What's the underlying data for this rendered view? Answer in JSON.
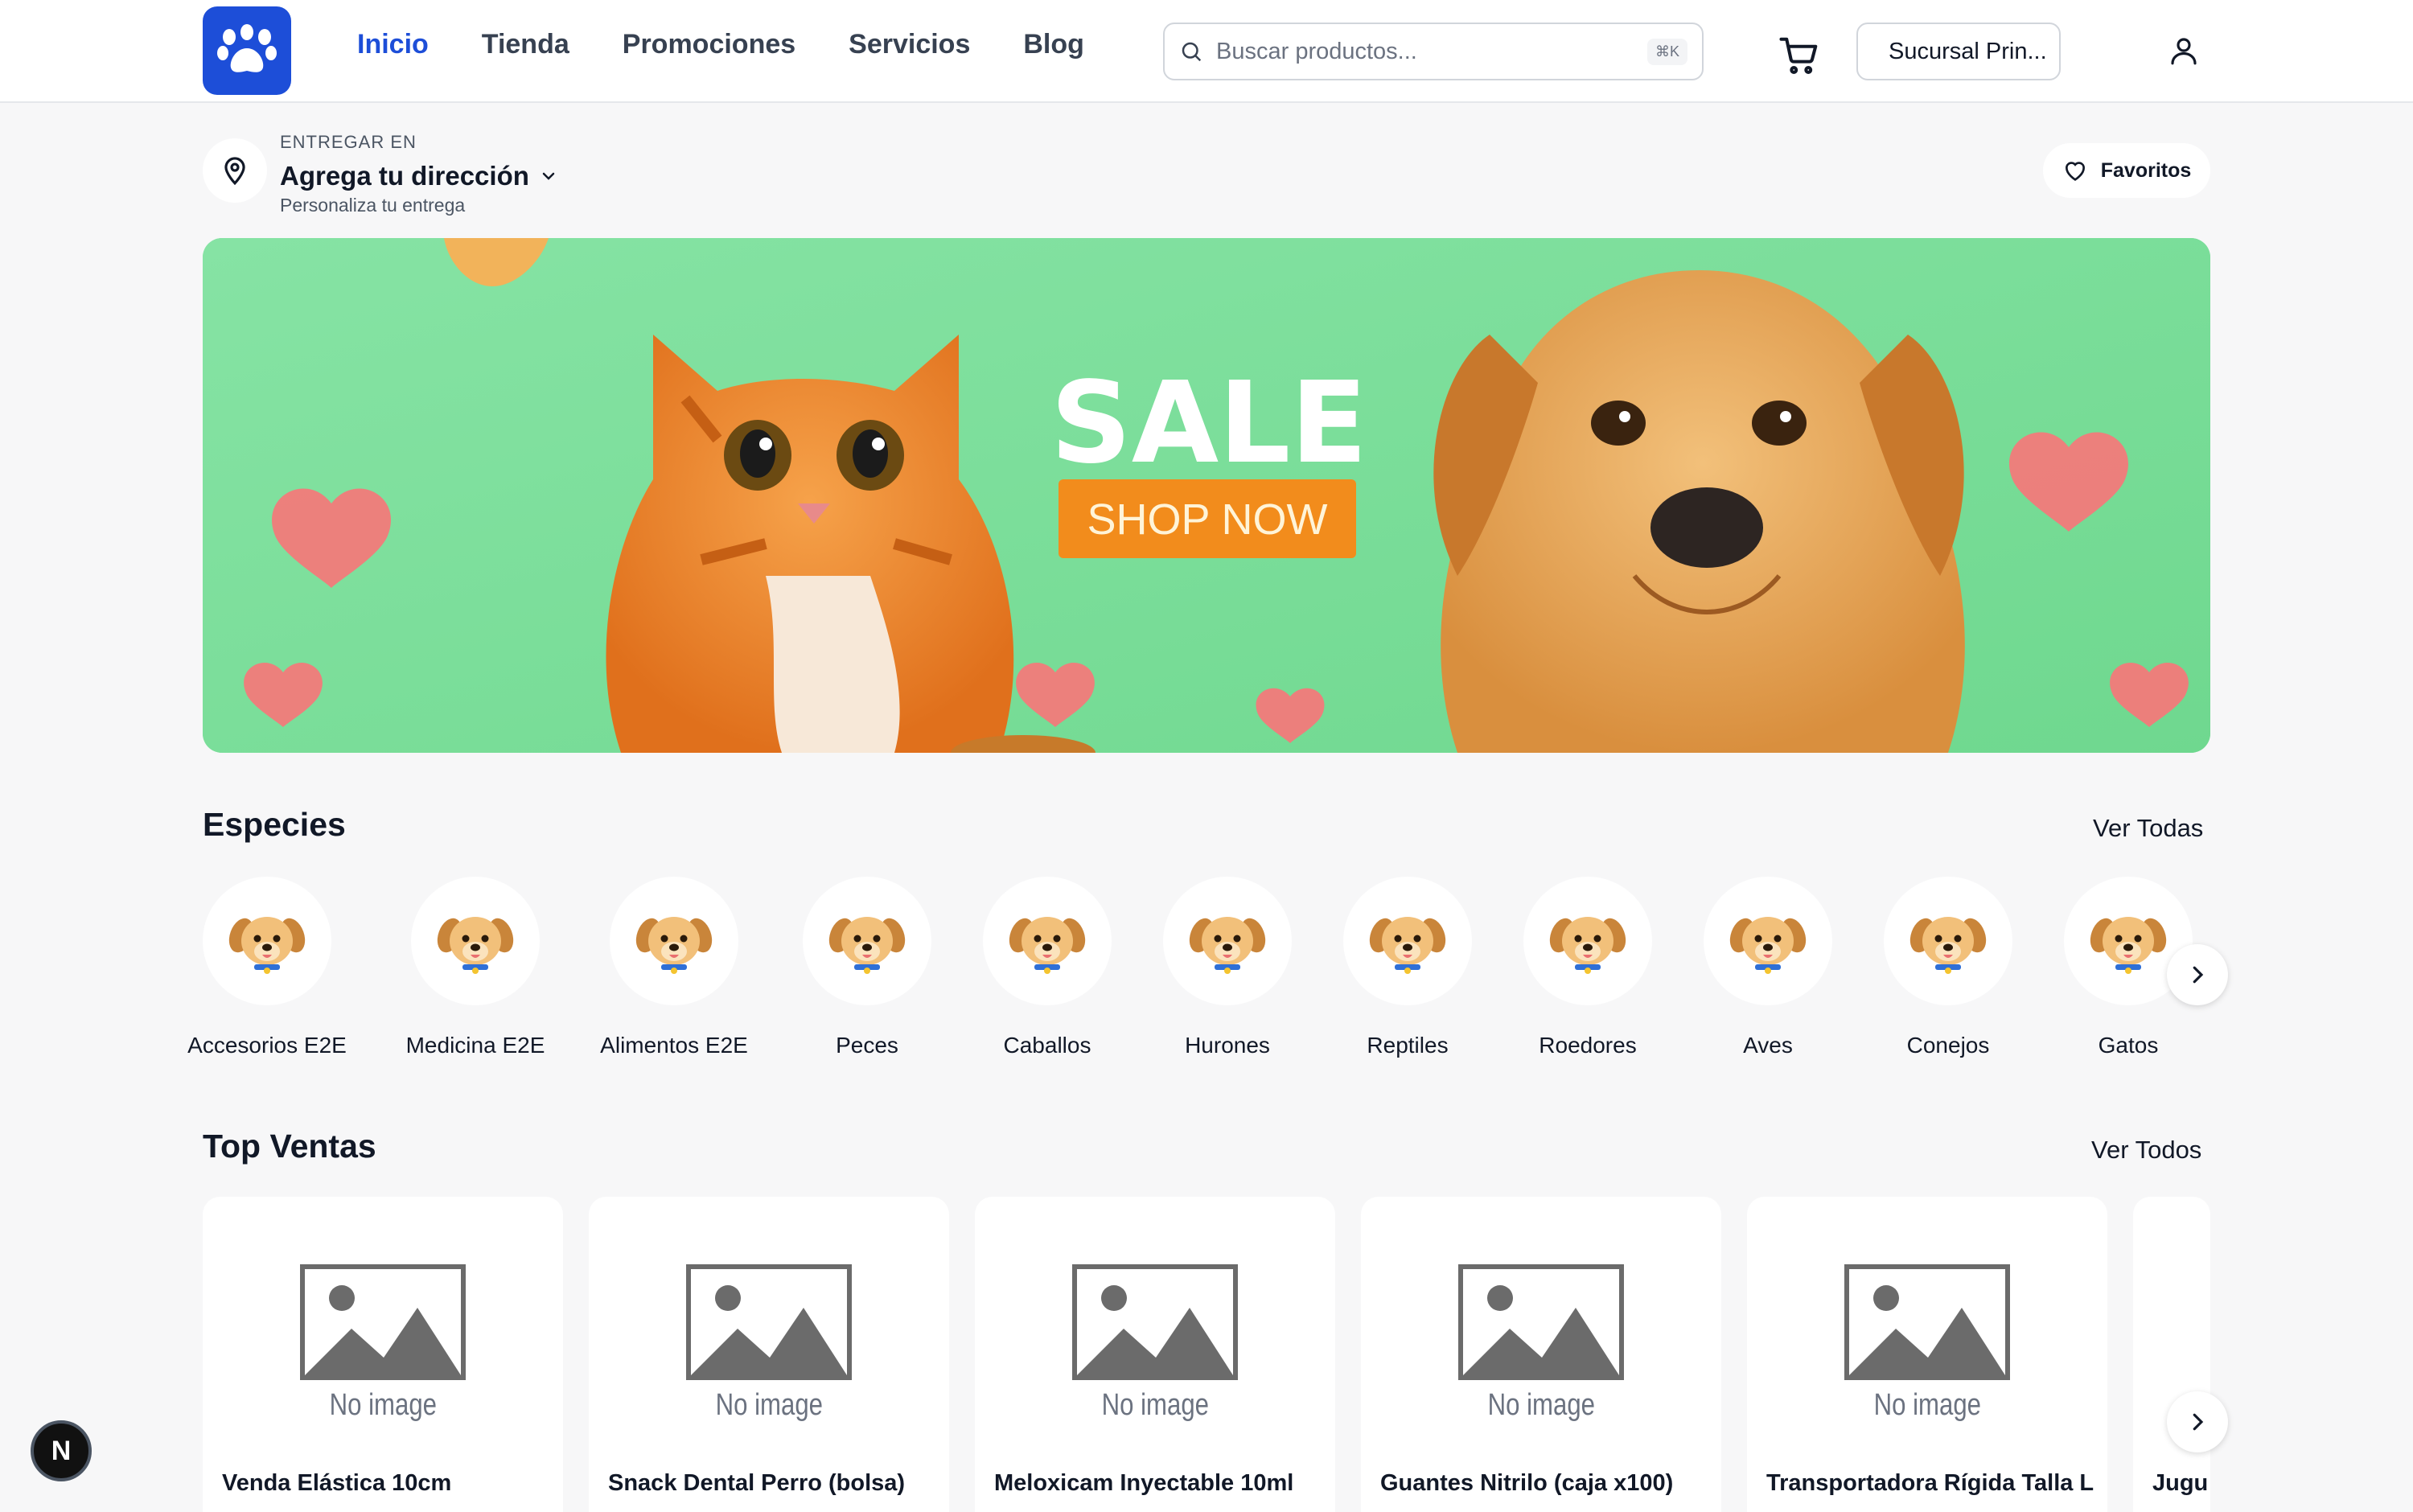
{
  "header": {
    "logo": "paw-icon",
    "nav": [
      {
        "label": "Inicio",
        "active": true
      },
      {
        "label": "Tienda"
      },
      {
        "label": "Promociones"
      },
      {
        "label": "Servicios"
      },
      {
        "label": "Blog"
      }
    ],
    "search": {
      "placeholder": "Buscar productos...",
      "shortcut": "⌘K"
    },
    "branch_label": "Sucursal Prin...",
    "accent_color": "#1d4ed8"
  },
  "delivery": {
    "eyebrow": "ENTREGAR EN",
    "title": "Agrega tu dirección",
    "subtitle": "Personaliza tu entrega"
  },
  "favorites_label": "Favoritos",
  "banner": {
    "headline": "SALE",
    "cta": "SHOP NOW",
    "background": "#7ddf9a",
    "cta_color": "#f28c1c"
  },
  "species": {
    "title": "Especies",
    "see_all": "Ver Todas",
    "items": [
      {
        "label": "Accesorios E2E"
      },
      {
        "label": "Medicina E2E"
      },
      {
        "label": "Alimentos E2E"
      },
      {
        "label": "Peces"
      },
      {
        "label": "Caballos"
      },
      {
        "label": "Hurones"
      },
      {
        "label": "Reptiles"
      },
      {
        "label": "Roedores"
      },
      {
        "label": "Aves"
      },
      {
        "label": "Conejos"
      },
      {
        "label": "Gatos"
      }
    ]
  },
  "top_sales": {
    "title": "Top Ventas",
    "see_all": "Ver Todos",
    "placeholder_text": "No image",
    "products": [
      {
        "name": "Venda Elástica 10cm"
      },
      {
        "name": "Snack Dental Perro (bolsa)"
      },
      {
        "name": "Meloxicam Inyectable 10ml"
      },
      {
        "name": "Guantes Nitrilo (caja x100)"
      },
      {
        "name": "Transportadora Rígida Talla L"
      },
      {
        "name": "Jugu"
      }
    ]
  },
  "dev_badge": "N"
}
